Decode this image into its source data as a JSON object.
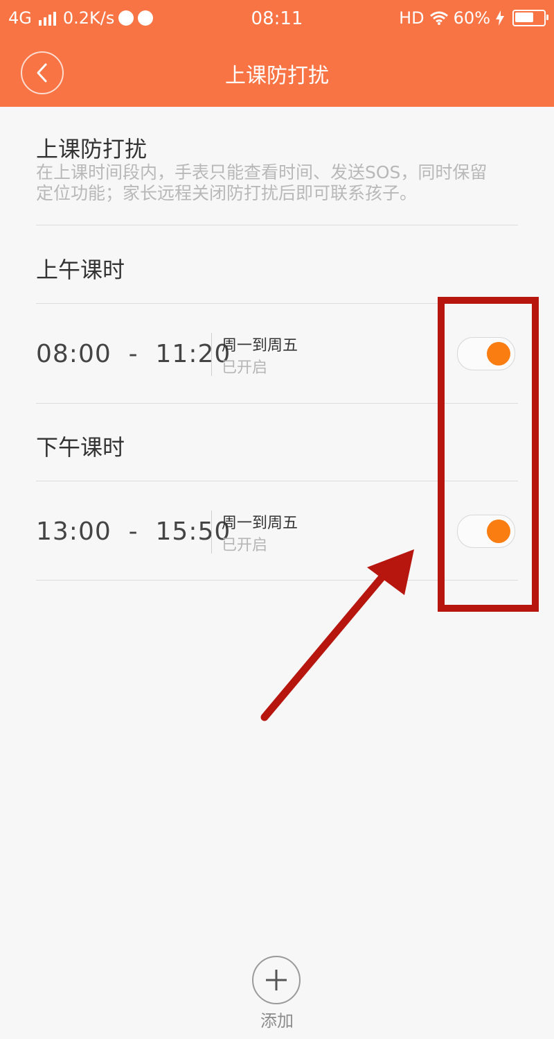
{
  "status_bar": {
    "network": "4G",
    "speed": "0.2K/s",
    "time": "08:11",
    "hd": "HD",
    "battery": "60%",
    "battery_level": 0.6
  },
  "header": {
    "title": "上课防打扰",
    "back_icon": "chevron-left-icon",
    "background_color": "#f87445"
  },
  "intro": {
    "title": "上课防打扰",
    "description_line1": "在上课时间段内，手表只能查看时间、发送SOS，同时保留",
    "description_line2": "定位功能；家长远程关闭防打扰后即可联系孩子。"
  },
  "morning": {
    "title": "上午课时",
    "time": "08:00  -  11:20",
    "days": "周一到周五",
    "status": "已开启",
    "enabled": true
  },
  "afternoon": {
    "title": "下午课时",
    "time": "13:00  -  15:50",
    "days": "周一到周五",
    "status": "已开启",
    "enabled": true
  },
  "add": {
    "label": "添加",
    "icon": "plus-icon"
  },
  "colors": {
    "accent": "#fa7d12",
    "annotation": "#b7160f"
  }
}
